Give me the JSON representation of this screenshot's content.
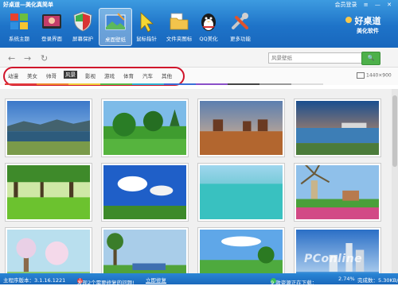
{
  "window": {
    "title": "好桌道—美化真简单",
    "top_links": [
      "会员登录",
      "≡",
      "—",
      "✕"
    ]
  },
  "toolbar": {
    "items": [
      {
        "label": "系统主题",
        "icon": "windows-flag-icon"
      },
      {
        "label": "登录界面",
        "icon": "login-screen-icon"
      },
      {
        "label": "屏幕保护",
        "icon": "shield-icon"
      },
      {
        "label": "桌面壁纸",
        "icon": "wallpaper-icon",
        "active": true
      },
      {
        "label": "鼠标指针",
        "icon": "cursor-icon"
      },
      {
        "label": "文件夹图标",
        "icon": "folder-icon"
      },
      {
        "label": "QQ美化",
        "icon": "qq-penguin-icon"
      },
      {
        "label": "更多功能",
        "icon": "tools-icon"
      }
    ],
    "brand": {
      "line1": "好桌道",
      "line2": "美化软件"
    }
  },
  "nav": {
    "back": "←",
    "forward": "→",
    "refresh": "↻"
  },
  "search": {
    "placeholder": "风景壁纸",
    "button": "🔍"
  },
  "categories": [
    "动漫",
    "美女",
    "帅哥",
    "风景",
    "影视",
    "游戏",
    "体育",
    "汽车",
    "其他"
  ],
  "selected_category": "风景",
  "resolution": "1440×900",
  "color_strip": [
    "#e33b3b",
    "#f08a2c",
    "#f2d13a",
    "#58c04a",
    "#2fb5d6",
    "#3a6fd8",
    "#8a4fc8",
    "#444444",
    "#999999",
    "#dddddd"
  ],
  "status": {
    "version": "主程序版本：3.1.16.1221",
    "warning_icon": "!",
    "warning": "发现2个需要修复的问题!",
    "fix_link": "立即修复",
    "downloads": "9 款资源正在下载：",
    "progress": "2.74%",
    "size": "完成数：5.30KB/s"
  },
  "watermark": "PConline"
}
